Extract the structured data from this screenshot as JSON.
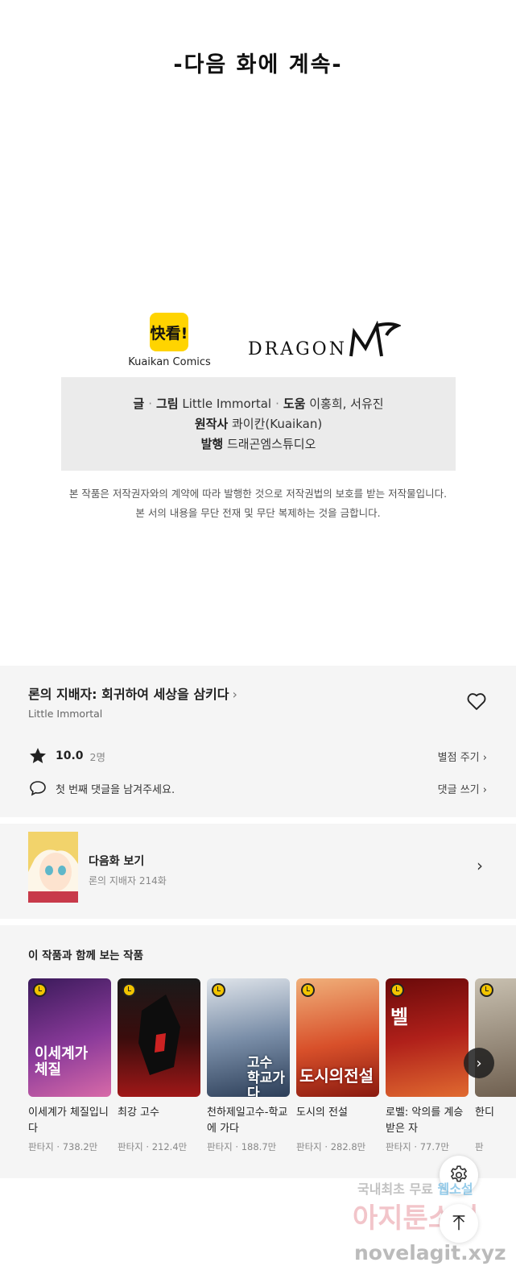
{
  "episode_end": {
    "to_be_continued": "-다음 화에 계속-"
  },
  "logos": {
    "kuaikan_mark": "快看!",
    "kuaikan_label": "Kuaikan Comics",
    "dragonm": "DRAGON M"
  },
  "credits": {
    "story_art_label": "글",
    "art_label": "그림",
    "story_art_value": "Little Immortal",
    "assist_label": "도움",
    "assist_value": "이홍희, 서유진",
    "original_label": "원작사",
    "original_value": "콰이칸(Kuaikan)",
    "publisher_label": "발행",
    "publisher_value": "드래곤엠스튜디오"
  },
  "notice": {
    "line1": "본 작품은 저작권자와의 계약에 따라 발행한 것으로 저작권법의 보호를 받는 저작물입니다.",
    "line2": "본 서의 내용을 무단 전재 및 무단 복제하는 것을 금합니다."
  },
  "series": {
    "title": "론의 지배자: 회귀하여 세상을 삼키다",
    "author": "Little Immortal",
    "rating": "10.0",
    "rating_count": "2명",
    "rate_link": "별점 주기",
    "comment_prompt": "첫 번째 댓글을 남겨주세요.",
    "comment_link": "댓글 쓰기"
  },
  "next_episode": {
    "label": "다음화 보기",
    "subtitle": "론의 지배자 214화"
  },
  "recommendations": {
    "heading": "이 작품과 함께 보는 작품",
    "items": [
      {
        "title": "이세계가 체질입니다",
        "genre": "판타지",
        "views": "738.2만",
        "cover_text": "이세계가 체질"
      },
      {
        "title": "최강 고수",
        "genre": "판타지",
        "views": "212.4만",
        "cover_text": ""
      },
      {
        "title": "천하제일고수-학교에 가다",
        "genre": "판타지",
        "views": "188.7만",
        "cover_text": "고수 학교가다"
      },
      {
        "title": "도시의 전설",
        "genre": "판타지",
        "views": "282.8만",
        "cover_text": "도시의전설"
      },
      {
        "title": "로벨: 악의를 계승받은 자",
        "genre": "판타지",
        "views": "77.7만",
        "cover_text": "벨"
      },
      {
        "title": "한디",
        "genre": "판",
        "views": "",
        "cover_text": ""
      }
    ]
  },
  "watermark": {
    "line1a": "국내최초 무료",
    "line1b": "웹소설",
    "line2": "아지툰소설",
    "line3": "novelagit.xyz"
  },
  "colors": {
    "panel_bg": "#f5f5f5",
    "credit_bg": "#ebebeb",
    "kuaikan_yellow": "#ffd400",
    "badge_yellow": "#f2c400"
  }
}
